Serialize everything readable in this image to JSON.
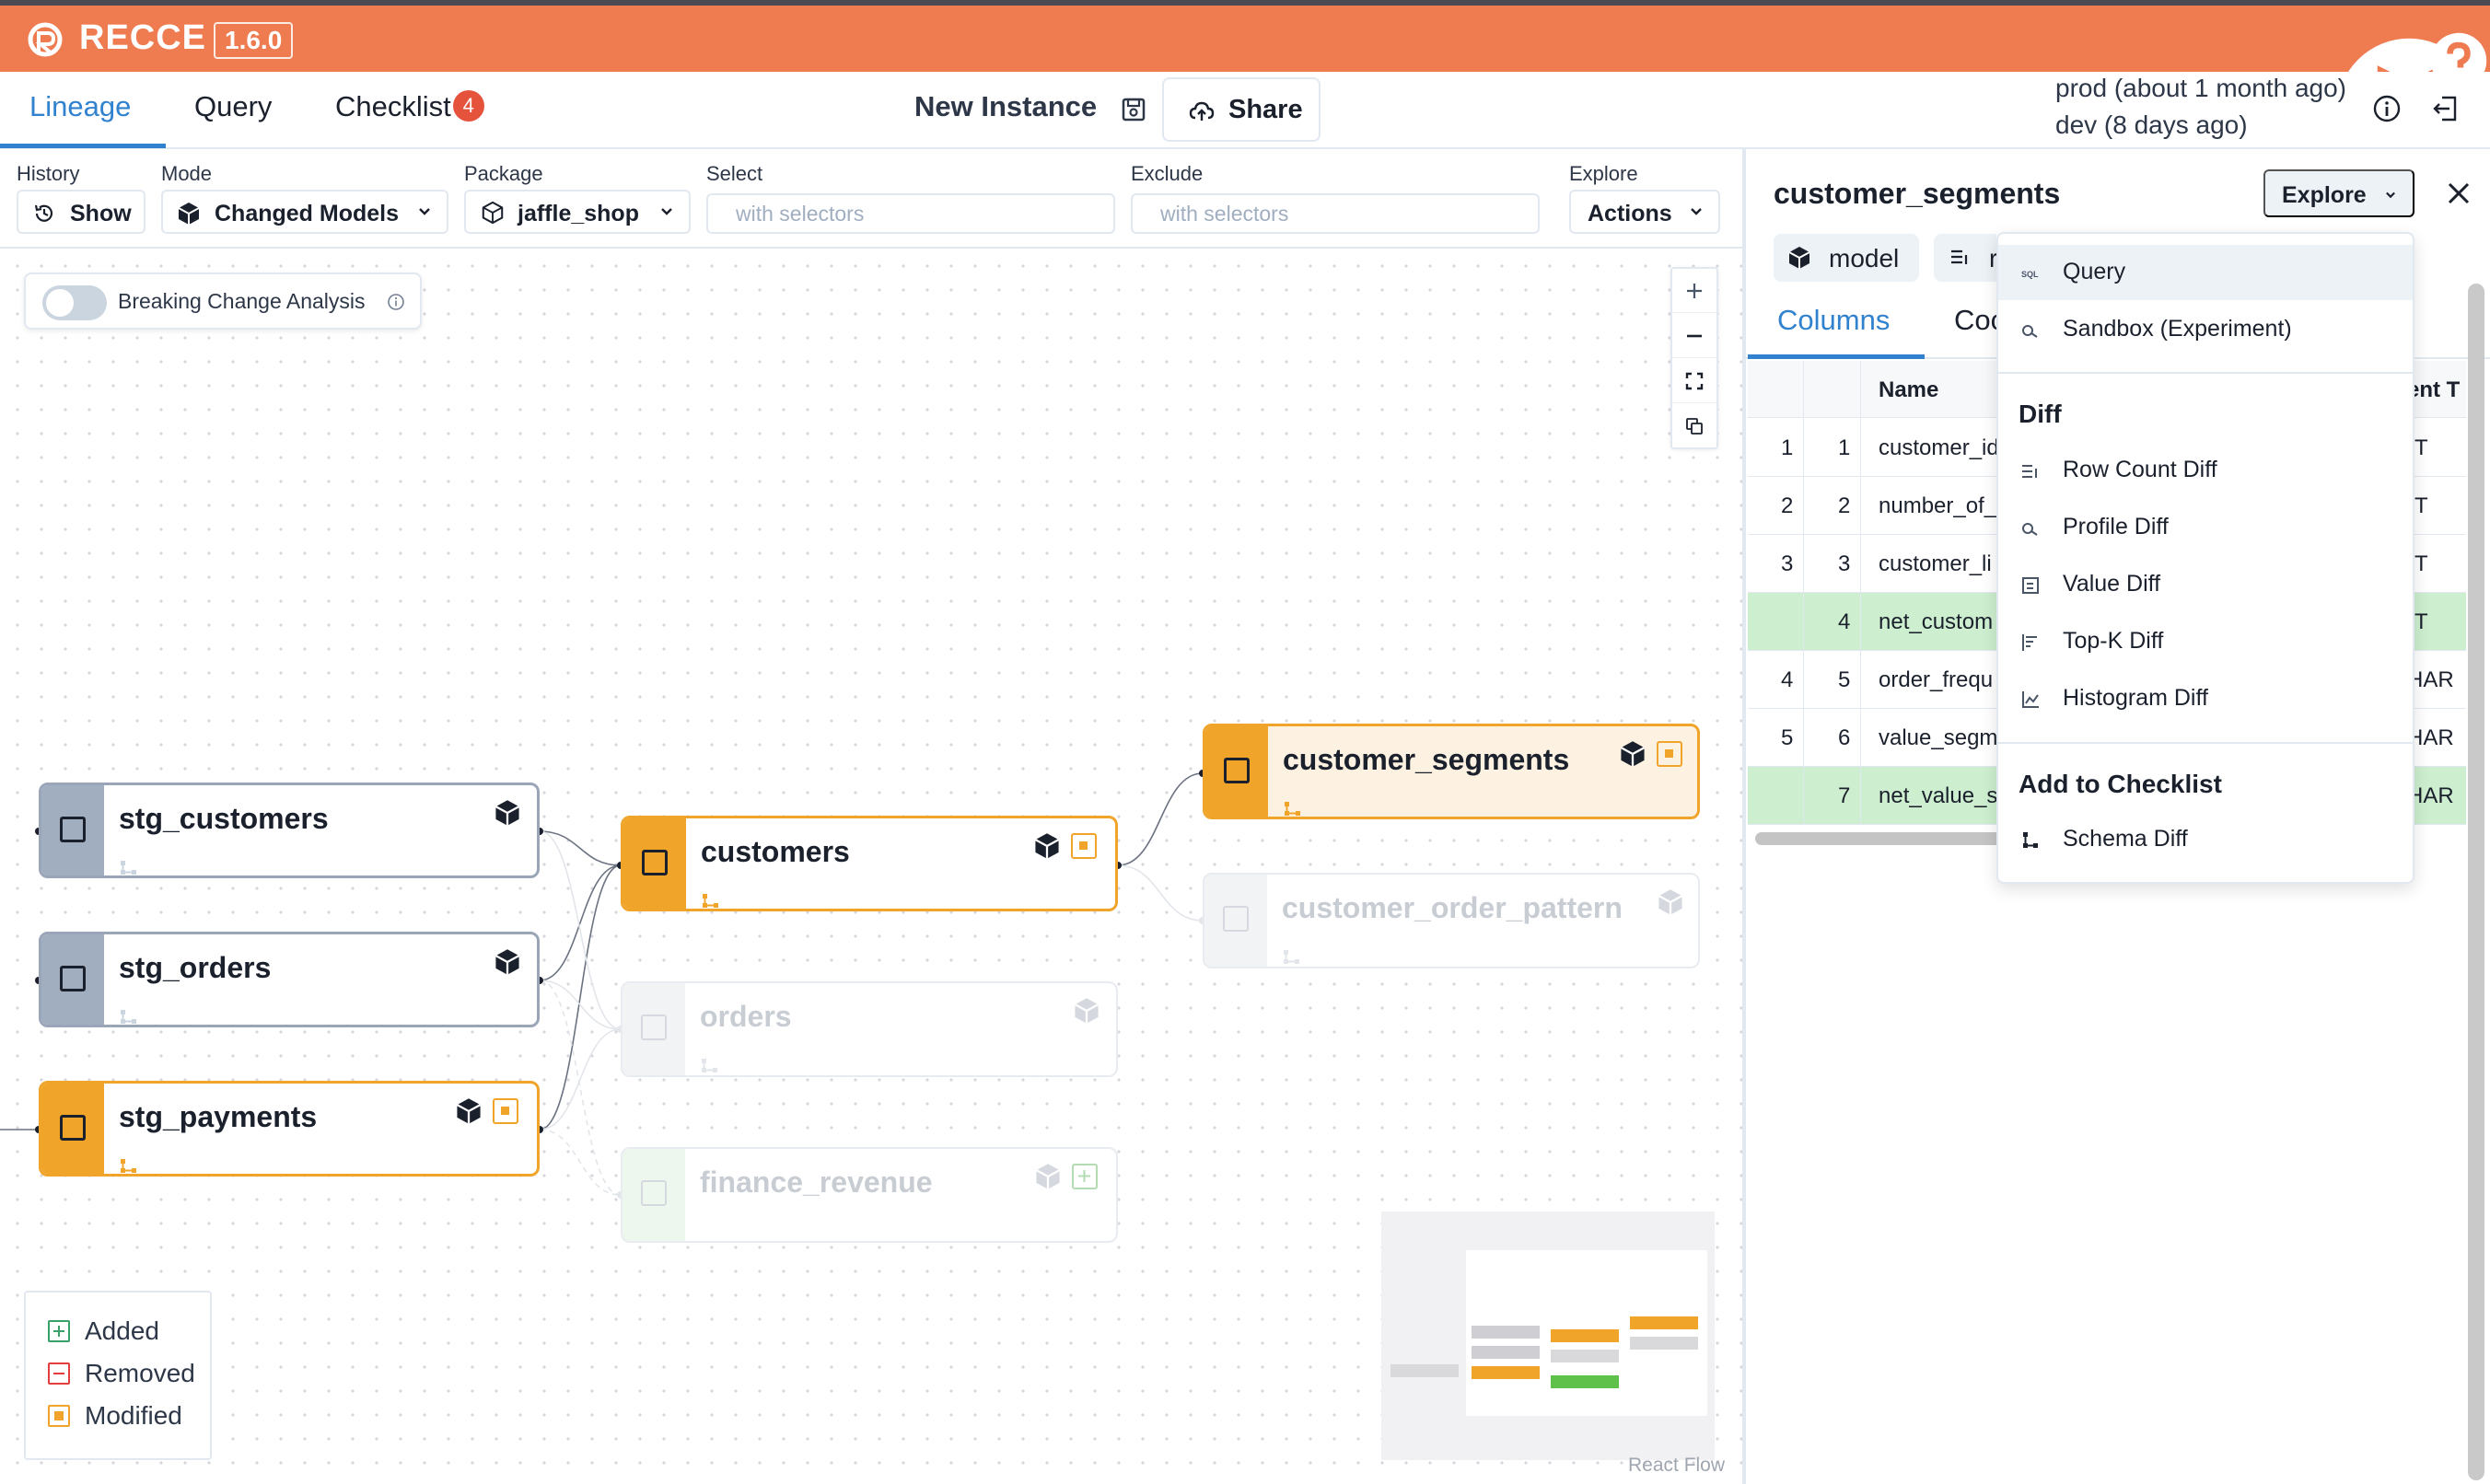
{
  "app": {
    "brand": "RECCE",
    "version": "1.6.0",
    "accent": "#ef7b50",
    "icons": [
      "github-icon",
      "slack-icon",
      "help-icon"
    ]
  },
  "nav": {
    "tabs": [
      {
        "label": "Lineage",
        "active": true
      },
      {
        "label": "Query",
        "active": false
      },
      {
        "label": "Checklist",
        "active": false,
        "badge": "4"
      }
    ],
    "instance_title": "New Instance",
    "share_label": "Share",
    "env_prod": "prod (about 1 month ago)",
    "env_dev": "dev (8 days ago)"
  },
  "filters": {
    "history": {
      "label": "History",
      "value": "Show"
    },
    "mode": {
      "label": "Mode",
      "value": "Changed Models"
    },
    "package": {
      "label": "Package",
      "value": "jaffle_shop"
    },
    "select": {
      "label": "Select",
      "placeholder": "with selectors"
    },
    "exclude": {
      "label": "Exclude",
      "placeholder": "with selectors"
    },
    "explore": {
      "label": "Explore",
      "value": "Actions"
    }
  },
  "canvas": {
    "breaking_change_label": "Breaking Change Analysis",
    "breaking_change_enabled": false,
    "nodes": [
      {
        "name": "stg_customers",
        "status": "unchanged"
      },
      {
        "name": "stg_orders",
        "status": "unchanged"
      },
      {
        "name": "stg_payments",
        "status": "modified"
      },
      {
        "name": "customers",
        "status": "modified"
      },
      {
        "name": "orders",
        "status": "faded"
      },
      {
        "name": "finance_revenue",
        "status": "faded-added"
      },
      {
        "name": "customer_segments",
        "status": "modified-selected"
      },
      {
        "name": "customer_order_pattern",
        "status": "faded"
      }
    ],
    "legend": [
      {
        "label": "Added",
        "color": "#38a169"
      },
      {
        "label": "Removed",
        "color": "#e53e3e"
      },
      {
        "label": "Modified",
        "color": "#f0a42a"
      }
    ],
    "attribution": "React Flow"
  },
  "panel": {
    "title": "customer_segments",
    "explore_label": "Explore",
    "chips": [
      "model",
      "r"
    ],
    "tabs": [
      {
        "label": "Columns",
        "active": true
      },
      {
        "label": "Coc",
        "active": false
      }
    ],
    "column_header_name": "Name",
    "column_header_type": "ent T",
    "rows": [
      {
        "base": "1",
        "current": "1",
        "name": "customer_id",
        "type": "T",
        "added": false
      },
      {
        "base": "2",
        "current": "2",
        "name": "number_of_",
        "type": "T",
        "added": false
      },
      {
        "base": "3",
        "current": "3",
        "name": "customer_li",
        "type": "T",
        "added": false
      },
      {
        "base": "",
        "current": "4",
        "name": "net_custom",
        "type": "T",
        "added": true
      },
      {
        "base": "4",
        "current": "5",
        "name": "order_frequ",
        "type": "HAR",
        "added": false
      },
      {
        "base": "5",
        "current": "6",
        "name": "value_segm",
        "type": "HAR",
        "added": false
      },
      {
        "base": "",
        "current": "7",
        "name": "net_value_s",
        "type": "HAR",
        "added": true
      }
    ]
  },
  "explore_menu": {
    "items_top": [
      {
        "label": "Query",
        "icon": "sql-icon",
        "highlighted": true
      },
      {
        "label": "Sandbox (Experiment)",
        "icon": "sandbox-icon",
        "highlighted": false
      }
    ],
    "diff_group_label": "Diff",
    "diff_items": [
      {
        "label": "Row Count Diff",
        "icon": "row-count-icon"
      },
      {
        "label": "Profile Diff",
        "icon": "profile-icon"
      },
      {
        "label": "Value Diff",
        "icon": "value-diff-icon"
      },
      {
        "label": "Top-K Diff",
        "icon": "topk-icon"
      },
      {
        "label": "Histogram Diff",
        "icon": "histogram-icon"
      }
    ],
    "checklist_group_label": "Add to Checklist",
    "checklist_items": [
      {
        "label": "Schema Diff",
        "icon": "schema-icon"
      }
    ]
  }
}
